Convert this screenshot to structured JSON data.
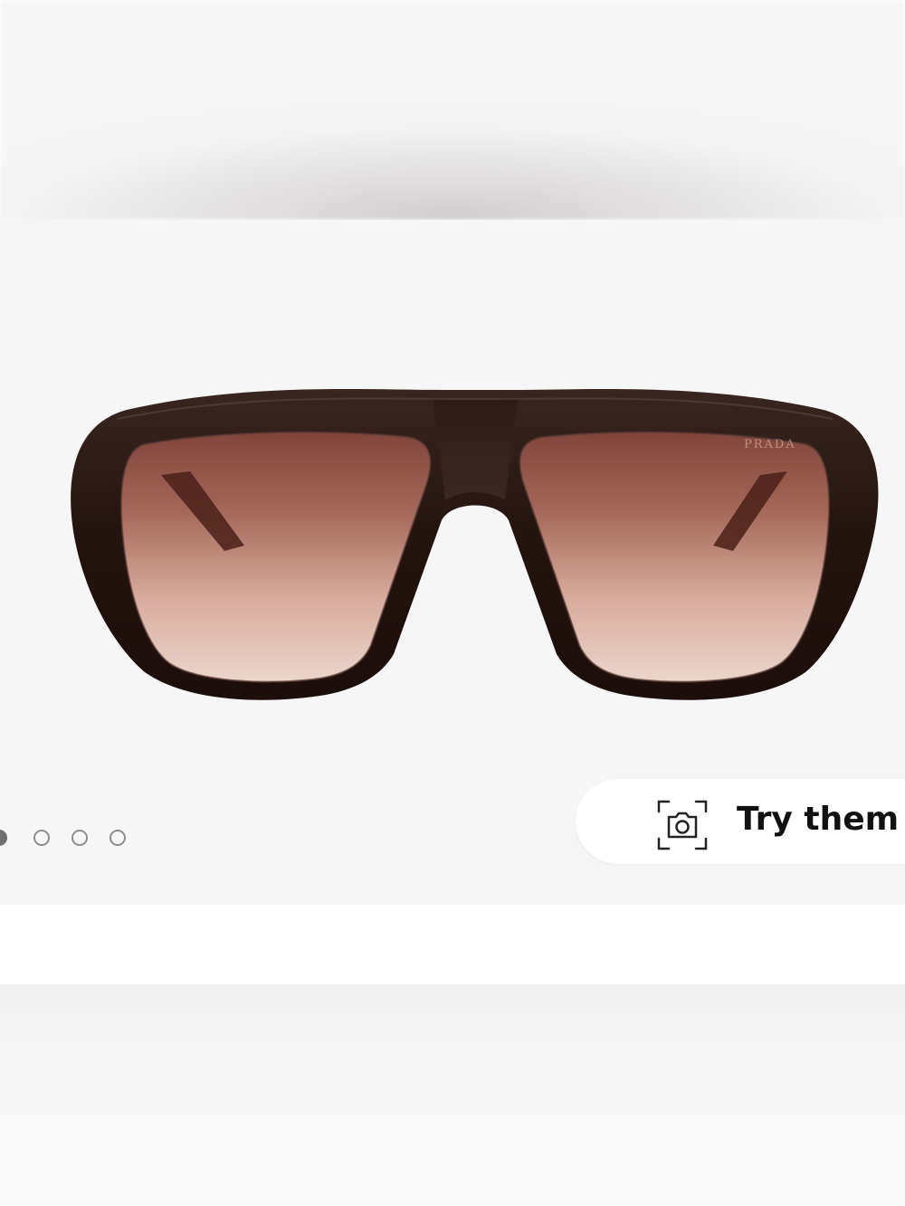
{
  "gallery": {
    "image_alt": "Brown sunglasses with gradient lenses",
    "brand_mark": "PRADA",
    "slides": [
      {
        "active": true
      },
      {
        "active": false
      },
      {
        "active": false
      },
      {
        "active": false
      }
    ]
  },
  "try_on": {
    "label": "Try them on",
    "icon": "camera-scan-icon"
  },
  "colors": {
    "frame": "#2b1a16",
    "lens_top": "#8d4c40",
    "lens_bottom": "#f2d9cf",
    "background": "#f6f6f6"
  }
}
